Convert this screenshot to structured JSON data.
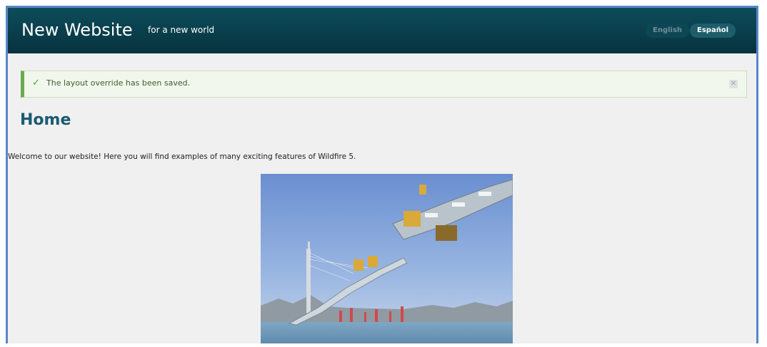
{
  "header": {
    "site_title": "New Website",
    "tagline": "for a new world",
    "languages": [
      {
        "label": "English",
        "active": false
      },
      {
        "label": "Español",
        "active": true
      }
    ]
  },
  "alert": {
    "message": "The layout override has been saved.",
    "icon": "check-icon",
    "close_icon": "close-icon",
    "accent_color": "#6daa4c"
  },
  "main": {
    "page_title": "Home",
    "intro_text": "Welcome to our website! Here you will find examples of many exciting features of Wildfire 5."
  },
  "colors": {
    "header_bg": "#06333e",
    "title_color": "#1b5a73"
  }
}
